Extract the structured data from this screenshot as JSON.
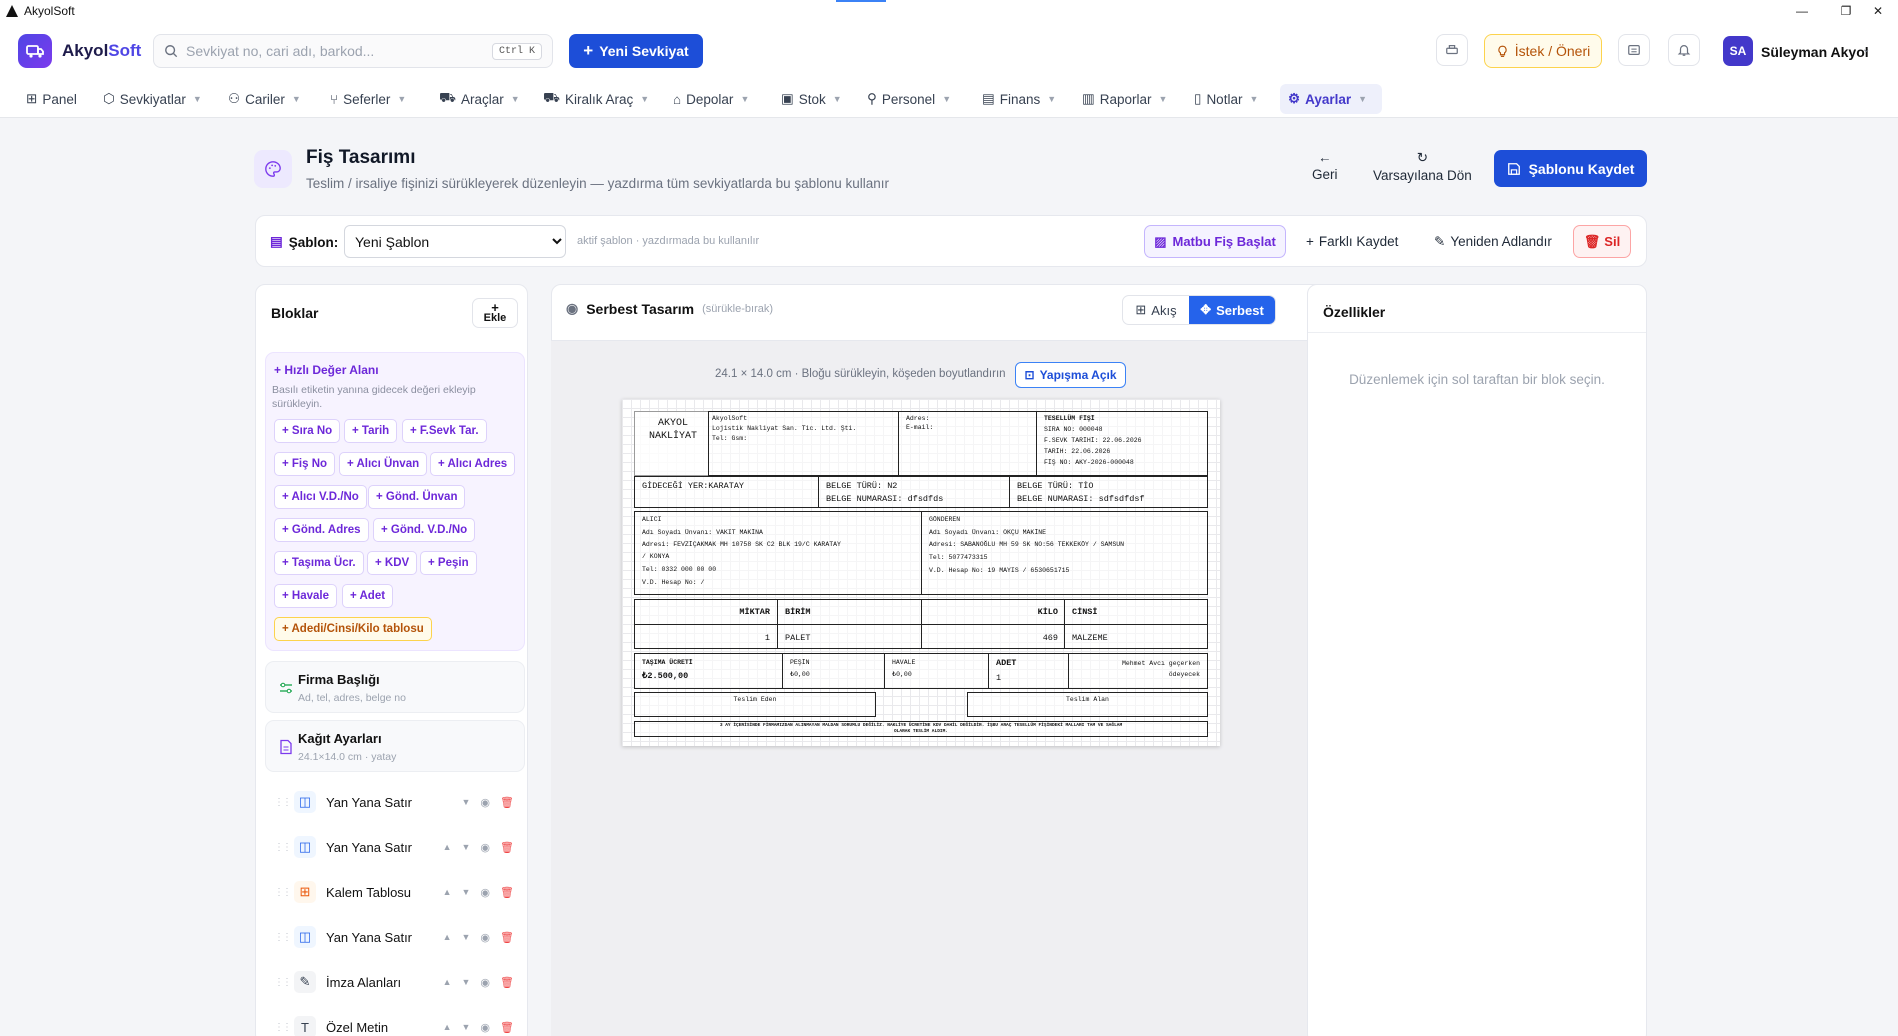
{
  "window": {
    "title": "AkyolSoft"
  },
  "header": {
    "brand_a": "Akyol",
    "brand_b": "Soft",
    "search_placeholder": "Sevkiyat no, cari adı, barkod...",
    "search_shortcut": "Ctrl K",
    "new_shipment": "Yeni Sevkiyat",
    "suggestion": "İstek / Öneri",
    "user_initials": "SA",
    "user_name": "Süleyman Akyol"
  },
  "nav": [
    {
      "label": "Panel",
      "icon": "grid-icon"
    },
    {
      "label": "Sevkiyatlar",
      "icon": "box-icon"
    },
    {
      "label": "Cariler",
      "icon": "users-icon"
    },
    {
      "label": "Seferler",
      "icon": "route-icon"
    },
    {
      "label": "Araçlar",
      "icon": "truck-icon"
    },
    {
      "label": "Kiralık Araç",
      "icon": "truck-icon"
    },
    {
      "label": "Depolar",
      "icon": "warehouse-icon"
    },
    {
      "label": "Stok",
      "icon": "package-icon"
    },
    {
      "label": "Personel",
      "icon": "user-icon"
    },
    {
      "label": "Finans",
      "icon": "wallet-icon"
    },
    {
      "label": "Raporlar",
      "icon": "chart-icon"
    },
    {
      "label": "Notlar",
      "icon": "note-icon"
    },
    {
      "label": "Ayarlar",
      "icon": "gear-icon",
      "active": true
    }
  ],
  "page": {
    "title": "Fiş Tasarımı",
    "subtitle": "Teslim / irsaliye fişinizi sürükleyerek düzenleyin — yazdırma tüm sevkiyatlarda bu şablonu kullanır",
    "back": "Geri",
    "reset": "Varsayılana Dön",
    "save": "Şablonu Kaydet"
  },
  "template": {
    "label": "Şablon:",
    "selected": "Yeni Şablon",
    "hint": "aktif şablon · yazdırmada bu kullanılır",
    "matbu": "Matbu Fiş Başlat",
    "save_as": "Farklı Kaydet",
    "rename": "Yeniden Adlandır",
    "delete": "Sil"
  },
  "blocks": {
    "title": "Bloklar",
    "add_plus": "+",
    "add_label": "Ekle",
    "quick_title": "Hızlı Değer Alanı",
    "quick_desc": "Basılı etiketin yanına gidecek değeri ekleyip sürükleyin.",
    "chips": [
      "+ Sıra No",
      "+ Tarih",
      "+ F.Sevk Tar.",
      "+ Fiş No",
      "+ Alıcı Ünvan",
      "+ Alıcı Adres",
      "+ Alıcı V.D./No",
      "+ Gönd. Ünvan",
      "+ Gönd. Adres",
      "+ Gönd. V.D./No",
      "+ Taşıma Ücr.",
      "+ KDV",
      "+ Peşin",
      "+ Havale",
      "+ Adet",
      "+ Adedi/Cinsi/Kilo tablosu"
    ],
    "firm_title": "Firma Başlığı",
    "firm_sub": "Ad, tel, adres, belge no",
    "paper_title": "Kağıt Ayarları",
    "paper_sub": "24.1×14.0 cm · yatay",
    "rows": [
      "Yan Yana Satır",
      "Yan Yana Satır",
      "Kalem Tablosu",
      "Yan Yana Satır",
      "İmza Alanları",
      "Özel Metin"
    ]
  },
  "canvas": {
    "title": "Serbest Tasarım",
    "hint": "(sürükle-bırak)",
    "mode_flow": "Akış",
    "mode_free": "Serbest",
    "dimension": "24.1 × 14.0 cm · Bloğu sürükleyin, köşeden boyutlandırın",
    "snap": "Yapışma Açık"
  },
  "receipt": {
    "company_l1": "AKYOL",
    "company_l2": "NAKLİYAT",
    "firm_name": "AkyolSoft",
    "firm_full": "Lojistik Nakliyat San. Tic. Ltd. Şti.",
    "firm_tel": "Tel:   Gsm:",
    "addr": "Adres:",
    "email": "E-mail:",
    "doc_title": "TESELLÜM FİŞİ",
    "sira": "SIRA NO: 000048",
    "fsevk": "F.SEVK TARİHİ: 22.06.2026",
    "tarih": "TARİH: 22.06.2026",
    "fis": "FİŞ NO: AKY-2026-000048",
    "dest": "GİDECEĞİ YER:KARATAY",
    "bt1": "BELGE TÜRÜ: N2",
    "bn1": "BELGE NUMARASI: dfsdfds",
    "bt2": "BELGE TÜRÜ: TİO",
    "bn2": "BELGE NUMARASI: sdfsdfdsf",
    "alici_h": "ALICI",
    "alici_1": "Adı Soyadı Ünvanı: VAKIT MAKİNA",
    "alici_2": "Adresi: FEVZİÇAKMAK MH 10758 SK C2 BLK 19/C KARATAY",
    "alici_3": "/ KONYA",
    "alici_4": "Tel: 0332 000 00 00",
    "alici_5": "V.D. Hesap No:  /",
    "gond_h": "GÖNDEREN",
    "gond_1": "Adı Soyadı Ünvanı: OKÇU MAKİNE",
    "gond_2": "Adresi: SABANOĞLU MH 59 SK NO:56 TEKKEKÖY / SAMSUN",
    "gond_3": "Tel: 5077473315",
    "gond_4": "V.D. Hesap No: 19 MAYIS / 6530651715",
    "th_miktar": "MİKTAR",
    "th_birim": "BİRİM",
    "th_kilo": "KİLO",
    "th_cinsi": "CİNSİ",
    "td_miktar": "1",
    "td_birim": "PALET",
    "td_kilo": "469",
    "td_cinsi": "MALZEME",
    "tasima_h": "TAŞIMA ÜCRETİ",
    "tasima_v": "₺2.500,00",
    "pesin_h": "PEŞİN",
    "pesin_v": "₺0,00",
    "havale_h": "HAVALE",
    "havale_v": "₺0,00",
    "adet_h": "ADET",
    "adet_v": "1",
    "note_1": "Mehmet Avcı geçerken",
    "note_2": "ödeyecek",
    "teslim_eden": "Teslim Eden",
    "teslim_alan": "Teslim Alan",
    "footer_1": "3 AY İÇERİSİNDE FİRMAMIZDAN ALINMAYAN MALDAN SORUMLU DEĞİLİZ. NAKLİYE ÜCRETİNE KDV DAHİL DEĞİLDİR. İŞBU ARAÇ TESELLÜM FİŞİNDEKİ MALLARI TAM VE SAĞLAM",
    "footer_2": "OLARAK TESLİM ALDIM."
  },
  "props": {
    "title": "Özellikler",
    "empty": "Düzenlemek için sol taraftan bir blok seçin."
  },
  "colors": {
    "primary": "#1d4ed8",
    "accent": "#6d28d9",
    "danger": "#dc2626",
    "warning": "#b45309"
  }
}
